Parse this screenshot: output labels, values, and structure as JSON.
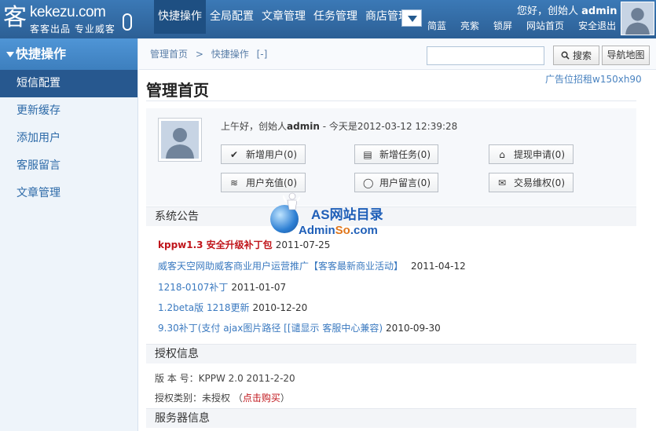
{
  "header": {
    "logo_text": "kekezu.com",
    "logo_sub": "客客出品 专业威客",
    "nav": [
      {
        "label": "快捷操作",
        "active": true
      },
      {
        "label": "全局配置"
      },
      {
        "label": "文章管理"
      },
      {
        "label": "任务管理"
      },
      {
        "label": "商店管理"
      }
    ],
    "greeting_prefix": "您好，创始人",
    "username": "admin",
    "util_links": [
      "简蓝",
      "亮紫",
      "锁屏",
      "网站首页",
      "安全退出"
    ]
  },
  "sidebar": {
    "title": "快捷操作",
    "items": [
      {
        "label": "短信配置",
        "active": true
      },
      {
        "label": "更新缓存"
      },
      {
        "label": "添加用户"
      },
      {
        "label": "客服留言"
      },
      {
        "label": "文章管理"
      }
    ]
  },
  "breadcrumb": {
    "home": "管理首页",
    "sep": ">",
    "current": "快捷操作",
    "toggle": "[-]"
  },
  "search": {
    "value": "",
    "placeholder": "",
    "button": "搜索"
  },
  "sitemap_button": "导航地图",
  "main": {
    "title": "管理首页",
    "ad_slot": "广告位招租w150xh90",
    "profile": {
      "greeting_pre": "上午好，创始人",
      "username": "admin",
      "greeting_post": " - 今天是2012-03-12 12:39:28"
    },
    "quick_buttons": [
      {
        "label": "新增用户(0)",
        "icon": "check-icon",
        "glyph": "✔"
      },
      {
        "label": "新增任务(0)",
        "icon": "task-icon",
        "glyph": "▤"
      },
      {
        "label": "提现申请(0)",
        "icon": "home-icon",
        "glyph": "⌂"
      },
      {
        "label": "用户充值(0)",
        "icon": "rss-icon",
        "glyph": "≋"
      },
      {
        "label": "用户留言(0)",
        "icon": "comment-icon",
        "glyph": "◯"
      },
      {
        "label": "交易维权(0)",
        "icon": "mail-icon",
        "glyph": "✉"
      }
    ],
    "notices": {
      "title": "系统公告",
      "items": [
        {
          "text": "kppw1.3 安全升级补丁包",
          "date": "2011-07-25",
          "hot": true
        },
        {
          "text": "威客天空网助威客商业用户运营推广【客客最新商业活动】",
          "date": "2011-04-12"
        },
        {
          "text": "1218-0107补丁",
          "date": "2011-01-07"
        },
        {
          "text": "1.2beta版 1218更新",
          "date": "2010-12-20"
        },
        {
          "text": "9.30补丁(支付 ajax图片路径 [[谴显示 客服中心兼容)",
          "date": "2010-09-30"
        }
      ]
    },
    "license": {
      "title": "授权信息",
      "version_label": "版 本 号：",
      "version_value": "KPPW 2.0 2011-2-20",
      "type_label": "授权类别：",
      "type_value": "未授权",
      "buy_open": "（",
      "buy_link": "点击购买",
      "buy_close": "）"
    },
    "server": {
      "title": "服务器信息"
    }
  },
  "watermark": {
    "line1": "AS网站目录",
    "line2_a": "Admin",
    "line2_b": "So",
    "line2_c": ".com"
  },
  "colors": {
    "header": "#2c5f95",
    "accent_blue": "#3b7ac0",
    "hot_red": "#c0151b"
  }
}
